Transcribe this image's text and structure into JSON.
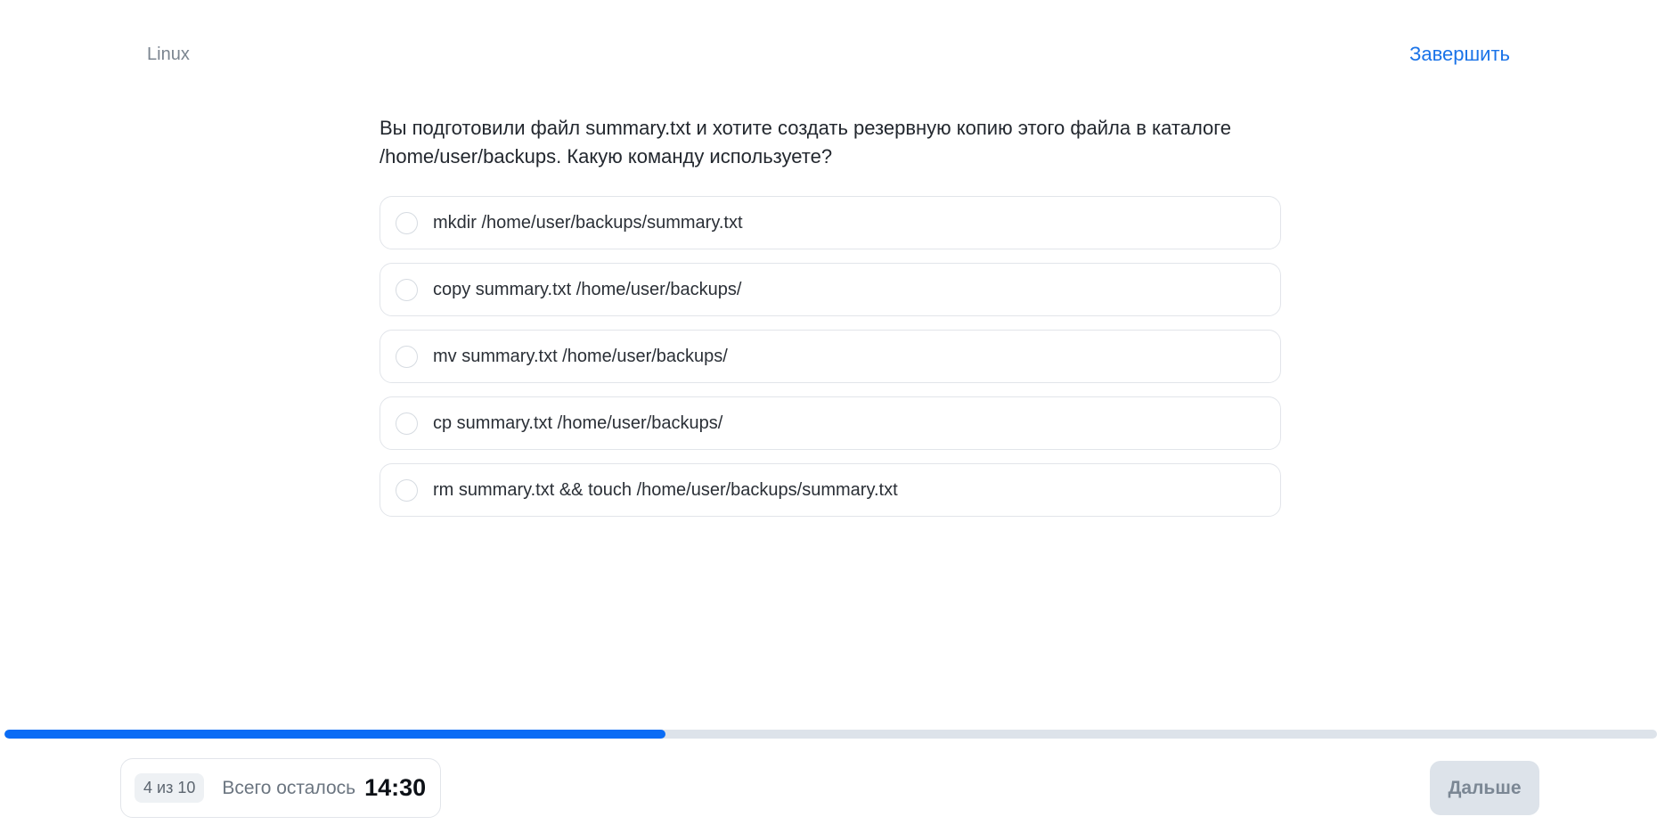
{
  "header": {
    "topic": "Linux",
    "finish_label": "Завершить"
  },
  "question": {
    "text": "Вы подготовили файл summary.txt и хотите создать резервную копию этого файла в каталоге /home/user/backups. Какую команду используете?",
    "options": [
      {
        "label": "mkdir /home/user/backups/summary.txt"
      },
      {
        "label": "copy summary.txt /home/user/backups/"
      },
      {
        "label": "mv summary.txt /home/user/backups/"
      },
      {
        "label": "cp summary.txt /home/user/backups/"
      },
      {
        "label": "rm summary.txt && touch /home/user/backups/summary.txt"
      }
    ]
  },
  "progress": {
    "fraction": 0.4
  },
  "footer": {
    "counter": "4 из 10",
    "remaining_label": "Всего осталось",
    "timer": "14:30",
    "next_label": "Дальше"
  },
  "colors": {
    "accent": "#0a6cf5",
    "link": "#1a73e8",
    "disabled_button_bg": "#dde3ea"
  }
}
